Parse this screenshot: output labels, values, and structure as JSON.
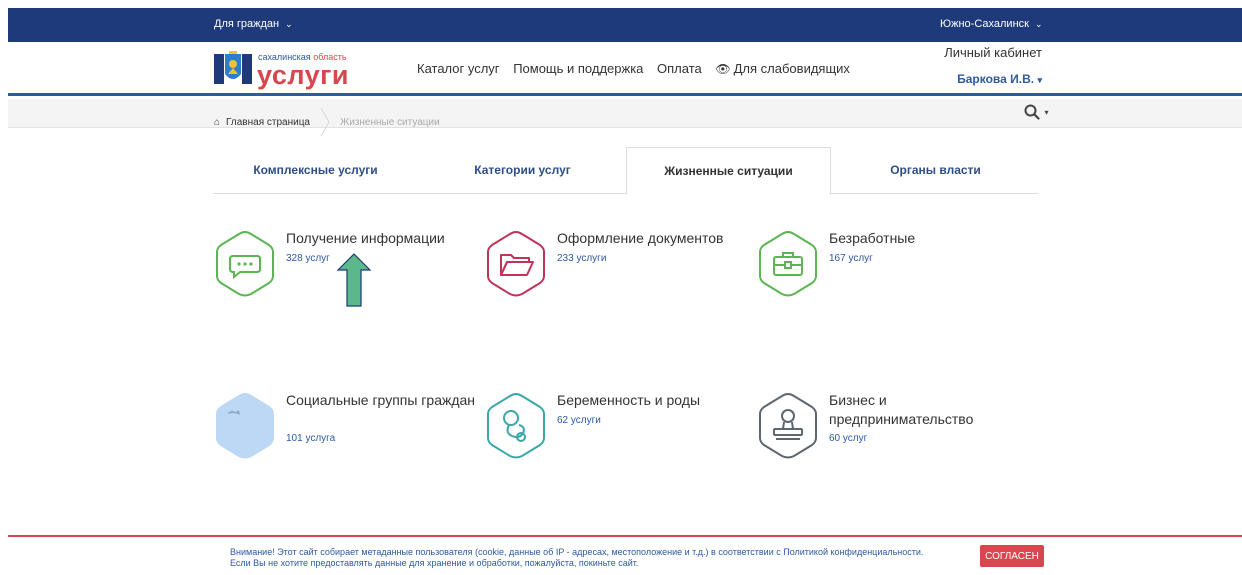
{
  "topbar": {
    "audience": "Для граждан",
    "city": "Южно-Сахалинск"
  },
  "logo": {
    "region_prefix": "сахалинская ",
    "region_word": "область",
    "brand": "услуги"
  },
  "nav": {
    "catalog": "Каталог услуг",
    "help": "Помощь и поддержка",
    "payment": "Оплата",
    "accessibility": "Для слабовидящих"
  },
  "account": {
    "cabinet": "Личный кабинет",
    "user": "Баркова И.В."
  },
  "breadcrumb": {
    "home": "Главная страница",
    "current": "Жизненные ситуации"
  },
  "tabs": [
    {
      "label": "Комплексные услуги"
    },
    {
      "label": "Категории услуг"
    },
    {
      "label": "Жизненные ситуации"
    },
    {
      "label": "Органы власти"
    }
  ],
  "categories": [
    {
      "title": "Получение информации",
      "count": "328 услуг",
      "icon": "chat-bubble-icon",
      "color": "#5ab552"
    },
    {
      "title": "Оформление документов",
      "count": "233 услуги",
      "icon": "folder-icon",
      "color": "#c2335a"
    },
    {
      "title": "Безработные",
      "count": "167 услуг",
      "icon": "briefcase-icon",
      "color": "#5ab552"
    },
    {
      "title": "Социальные группы граждан",
      "count": "101 услуга",
      "icon": "social-groups-icon",
      "color": "#bcd8f5"
    },
    {
      "title": "Беременность и роды",
      "count": "62 услуги",
      "icon": "pacifier-icon",
      "color": "#3aa7a8"
    },
    {
      "title": "Бизнес и предпринимательство",
      "count": "60 услуг",
      "icon": "stamp-icon",
      "color": "#5c6770"
    }
  ],
  "cookie": {
    "line1": "Внимание! Этот сайт собирает метаданные пользователя (cookie, данные об IP - адресах, местоположение и т.д.) в соответствии с Политикой конфиденциальности.",
    "line2": "Если Вы не хотите предоставлять данные для хранение и обработки, пожалуйста, покиньте сайт.",
    "button": "СОГЛАСЕН"
  },
  "colors": {
    "topbar": "#1f3a7a",
    "accent": "#2d5aa0",
    "brand_red": "#d9464e"
  }
}
